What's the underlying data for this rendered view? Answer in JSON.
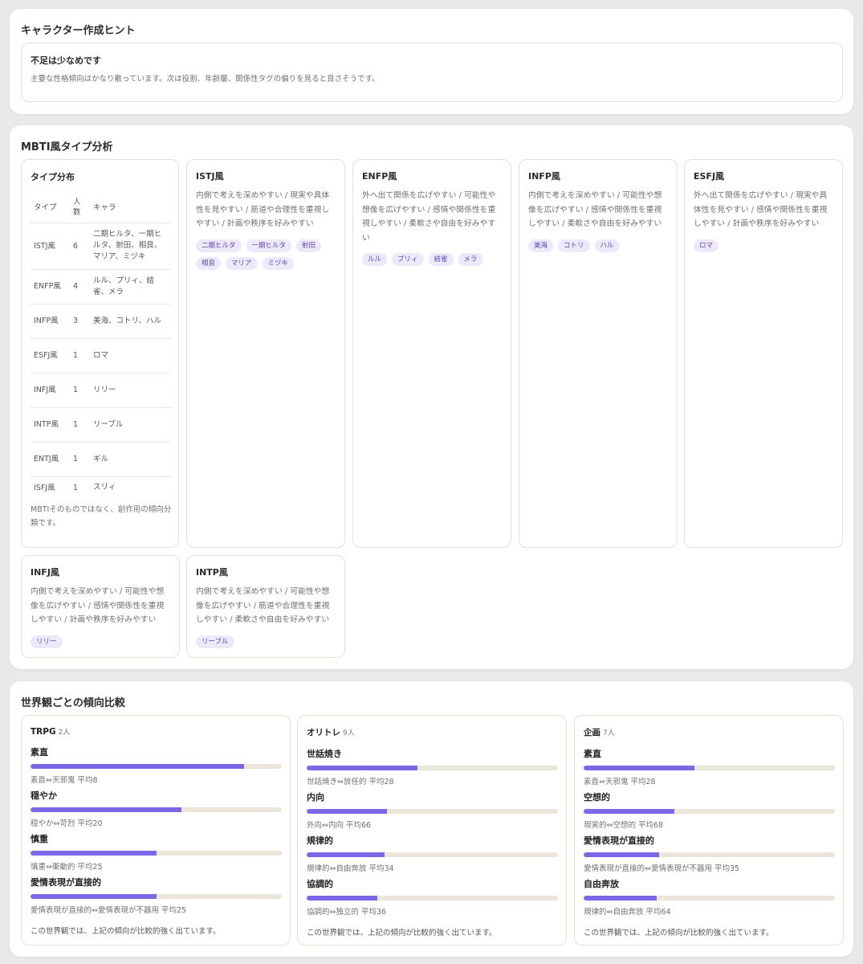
{
  "hints": {
    "title": "キャラクター作成ヒント",
    "card_title": "不足は少なめです",
    "card_desc": "主要な性格傾向はかなり散っています。次は役割、年齢層、関係性タグの偏りを見ると良さそうです。"
  },
  "mbti": {
    "title": "MBTI風タイプ分析",
    "dist": {
      "title": "タイプ分布",
      "headers": {
        "type": "タイプ",
        "count": "人数",
        "chars": "キャラ"
      },
      "rows": [
        {
          "type": "ISTJ風",
          "count": "6",
          "chars": "二期ヒルタ、一期ヒルタ、射田、相良、マリア、ミヅキ"
        },
        {
          "type": "ENFP風",
          "count": "4",
          "chars": "ルル、プリィ、結雀、メラ"
        },
        {
          "type": "INFP風",
          "count": "3",
          "chars": "美海、コトリ、ハル"
        },
        {
          "type": "ESFJ風",
          "count": "1",
          "chars": "ロマ"
        },
        {
          "type": "INFJ風",
          "count": "1",
          "chars": "リリー"
        },
        {
          "type": "INTP風",
          "count": "1",
          "chars": "リーブル"
        },
        {
          "type": "ENTJ風",
          "count": "1",
          "chars": "ギル"
        },
        {
          "type": "ISFJ風",
          "count": "1",
          "chars": "スリィ"
        }
      ],
      "note": "MBTIそのものではなく、創作用の傾向分類です。"
    },
    "types": [
      {
        "title": "ISTJ風",
        "desc": "内側で考えを深めやすい / 現実や具体性を見やすい / 筋道や合理性を重視しやすい / 計画や秩序を好みやすい",
        "chips": [
          "二期ヒルタ",
          "一期ヒルタ",
          "射田",
          "相良",
          "マリア",
          "ミヅキ"
        ]
      },
      {
        "title": "ENFP風",
        "desc": "外へ出て関係を広げやすい / 可能性や想像を広げやすい / 感情や関係性を重視しやすい / 柔軟さや自由を好みやすい",
        "chips": [
          "ルル",
          "プリィ",
          "結雀",
          "メラ"
        ]
      },
      {
        "title": "INFP風",
        "desc": "内側で考えを深めやすい / 可能性や想像を広げやすい / 感情や関係性を重視しやすい / 柔軟さや自由を好みやすい",
        "chips": [
          "美海",
          "コトリ",
          "ハル"
        ]
      },
      {
        "title": "ESFJ風",
        "desc": "外へ出て関係を広げやすい / 現実や具体性を見やすい / 感情や関係性を重視しやすい / 計画や秩序を好みやすい",
        "chips": [
          "ロマ"
        ]
      },
      {
        "title": "INFJ風",
        "desc": "内側で考えを深めやすい / 可能性や想像を広げやすい / 感情や関係性を重視しやすい / 計画や秩序を好みやすい",
        "chips": [
          "リリー"
        ]
      },
      {
        "title": "INTP風",
        "desc": "内側で考えを深めやすい / 可能性や想像を広げやすい / 筋道や合理性を重視しやすい / 柔軟さや自由を好みやすい",
        "chips": [
          "リーブル"
        ]
      }
    ]
  },
  "worlds": {
    "title": "世界観ごとの傾向比較",
    "cards": [
      {
        "name": "TRPG",
        "count": "2人",
        "traits": [
          {
            "label": "素直",
            "value": 85,
            "sub": "素直⇔天邪鬼 平均8"
          },
          {
            "label": "穏やか",
            "value": 60,
            "sub": "穏やか⇔苛烈 平均20"
          },
          {
            "label": "慎重",
            "value": 50,
            "sub": "慎重⇔衝動的 平均25"
          },
          {
            "label": "愛情表現が直接的",
            "value": 50,
            "sub": "愛情表現が直接的⇔愛情表現が不器用 平均25"
          }
        ],
        "note": "この世界観では、上記の傾向が比較的強く出ています。"
      },
      {
        "name": "オリトレ",
        "count": "9人",
        "traits": [
          {
            "label": "世話焼き",
            "value": 44,
            "sub": "世話焼き⇔放任的 平均28"
          },
          {
            "label": "内向",
            "value": 32,
            "sub": "外向⇔内向 平均66"
          },
          {
            "label": "規律的",
            "value": 31,
            "sub": "規律的⇔自由奔放 平均34"
          },
          {
            "label": "協調的",
            "value": 28,
            "sub": "協調的⇔独立的 平均36"
          }
        ],
        "note": "この世界観では、上記の傾向が比較的強く出ています。"
      },
      {
        "name": "企画",
        "count": "7人",
        "traits": [
          {
            "label": "素直",
            "value": 44,
            "sub": "素直⇔天邪鬼 平均28"
          },
          {
            "label": "空想的",
            "value": 36,
            "sub": "現実的⇔空想的 平均68"
          },
          {
            "label": "愛情表現が直接的",
            "value": 30,
            "sub": "愛情表現が直接的⇔愛情表現が不器用 平均35"
          },
          {
            "label": "自由奔放",
            "value": 29,
            "sub": "規律的⇔自由奔放 平均64"
          }
        ],
        "note": "この世界観では、上記の傾向が比較的強く出ています。"
      }
    ]
  }
}
